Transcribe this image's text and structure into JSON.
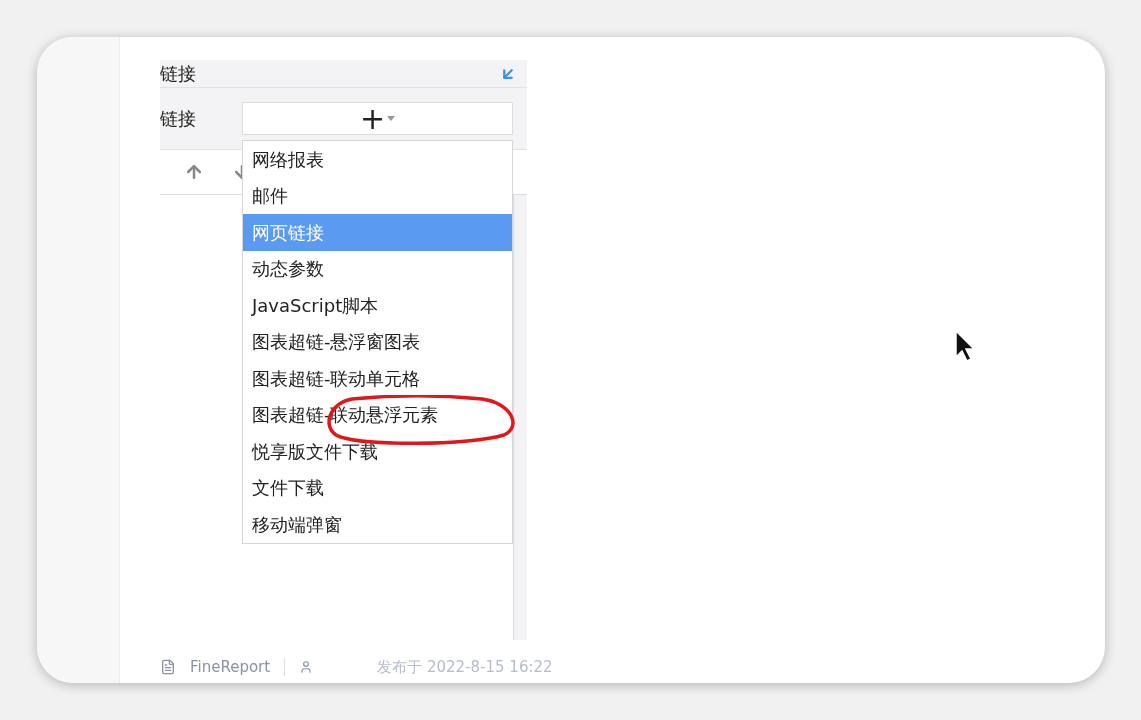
{
  "panel": {
    "header": "链接",
    "link_label": "链接",
    "add_button": {
      "label": "+"
    }
  },
  "menu": {
    "items": [
      {
        "label": "网络报表",
        "selected": false
      },
      {
        "label": "邮件",
        "selected": false
      },
      {
        "label": "网页链接",
        "selected": true
      },
      {
        "label": "动态参数",
        "selected": false
      },
      {
        "label": "JavaScript脚本",
        "selected": false
      },
      {
        "label": "图表超链-悬浮窗图表",
        "selected": false
      },
      {
        "label": "图表超链-联动单元格",
        "selected": false
      },
      {
        "label": "图表超链-联动悬浮元素",
        "selected": false
      },
      {
        "label": "悦享版文件下载",
        "selected": false
      },
      {
        "label": "文件下载",
        "selected": false
      },
      {
        "label": "移动端弹窗",
        "selected": false
      }
    ]
  },
  "footer": {
    "source": "FineReport",
    "published": "发布于 2022-8-15 16:22"
  }
}
